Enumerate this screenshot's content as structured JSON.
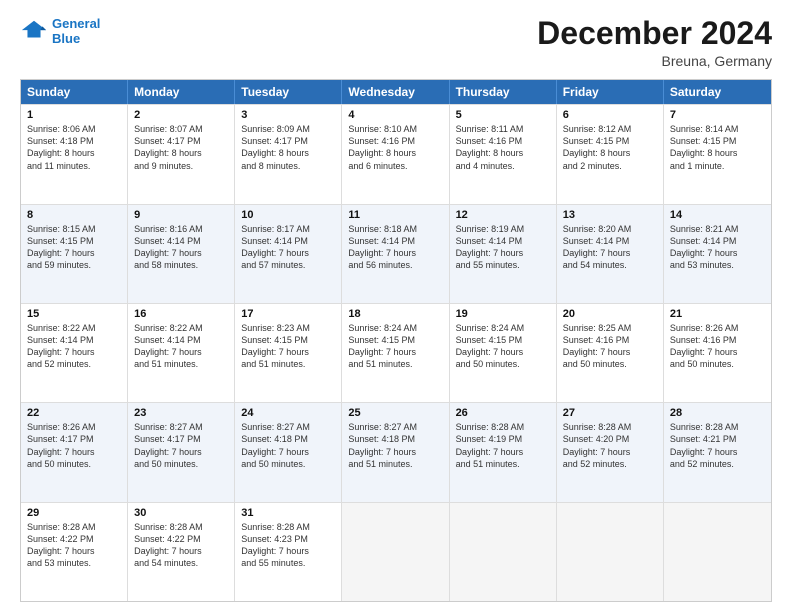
{
  "header": {
    "logo_line1": "General",
    "logo_line2": "Blue",
    "month": "December 2024",
    "location": "Breuna, Germany"
  },
  "weekdays": [
    "Sunday",
    "Monday",
    "Tuesday",
    "Wednesday",
    "Thursday",
    "Friday",
    "Saturday"
  ],
  "rows": [
    [
      {
        "day": "1",
        "lines": [
          "Sunrise: 8:06 AM",
          "Sunset: 4:18 PM",
          "Daylight: 8 hours",
          "and 11 minutes."
        ]
      },
      {
        "day": "2",
        "lines": [
          "Sunrise: 8:07 AM",
          "Sunset: 4:17 PM",
          "Daylight: 8 hours",
          "and 9 minutes."
        ]
      },
      {
        "day": "3",
        "lines": [
          "Sunrise: 8:09 AM",
          "Sunset: 4:17 PM",
          "Daylight: 8 hours",
          "and 8 minutes."
        ]
      },
      {
        "day": "4",
        "lines": [
          "Sunrise: 8:10 AM",
          "Sunset: 4:16 PM",
          "Daylight: 8 hours",
          "and 6 minutes."
        ]
      },
      {
        "day": "5",
        "lines": [
          "Sunrise: 8:11 AM",
          "Sunset: 4:16 PM",
          "Daylight: 8 hours",
          "and 4 minutes."
        ]
      },
      {
        "day": "6",
        "lines": [
          "Sunrise: 8:12 AM",
          "Sunset: 4:15 PM",
          "Daylight: 8 hours",
          "and 2 minutes."
        ]
      },
      {
        "day": "7",
        "lines": [
          "Sunrise: 8:14 AM",
          "Sunset: 4:15 PM",
          "Daylight: 8 hours",
          "and 1 minute."
        ]
      }
    ],
    [
      {
        "day": "8",
        "lines": [
          "Sunrise: 8:15 AM",
          "Sunset: 4:15 PM",
          "Daylight: 7 hours",
          "and 59 minutes."
        ]
      },
      {
        "day": "9",
        "lines": [
          "Sunrise: 8:16 AM",
          "Sunset: 4:14 PM",
          "Daylight: 7 hours",
          "and 58 minutes."
        ]
      },
      {
        "day": "10",
        "lines": [
          "Sunrise: 8:17 AM",
          "Sunset: 4:14 PM",
          "Daylight: 7 hours",
          "and 57 minutes."
        ]
      },
      {
        "day": "11",
        "lines": [
          "Sunrise: 8:18 AM",
          "Sunset: 4:14 PM",
          "Daylight: 7 hours",
          "and 56 minutes."
        ]
      },
      {
        "day": "12",
        "lines": [
          "Sunrise: 8:19 AM",
          "Sunset: 4:14 PM",
          "Daylight: 7 hours",
          "and 55 minutes."
        ]
      },
      {
        "day": "13",
        "lines": [
          "Sunrise: 8:20 AM",
          "Sunset: 4:14 PM",
          "Daylight: 7 hours",
          "and 54 minutes."
        ]
      },
      {
        "day": "14",
        "lines": [
          "Sunrise: 8:21 AM",
          "Sunset: 4:14 PM",
          "Daylight: 7 hours",
          "and 53 minutes."
        ]
      }
    ],
    [
      {
        "day": "15",
        "lines": [
          "Sunrise: 8:22 AM",
          "Sunset: 4:14 PM",
          "Daylight: 7 hours",
          "and 52 minutes."
        ]
      },
      {
        "day": "16",
        "lines": [
          "Sunrise: 8:22 AM",
          "Sunset: 4:14 PM",
          "Daylight: 7 hours",
          "and 51 minutes."
        ]
      },
      {
        "day": "17",
        "lines": [
          "Sunrise: 8:23 AM",
          "Sunset: 4:15 PM",
          "Daylight: 7 hours",
          "and 51 minutes."
        ]
      },
      {
        "day": "18",
        "lines": [
          "Sunrise: 8:24 AM",
          "Sunset: 4:15 PM",
          "Daylight: 7 hours",
          "and 51 minutes."
        ]
      },
      {
        "day": "19",
        "lines": [
          "Sunrise: 8:24 AM",
          "Sunset: 4:15 PM",
          "Daylight: 7 hours",
          "and 50 minutes."
        ]
      },
      {
        "day": "20",
        "lines": [
          "Sunrise: 8:25 AM",
          "Sunset: 4:16 PM",
          "Daylight: 7 hours",
          "and 50 minutes."
        ]
      },
      {
        "day": "21",
        "lines": [
          "Sunrise: 8:26 AM",
          "Sunset: 4:16 PM",
          "Daylight: 7 hours",
          "and 50 minutes."
        ]
      }
    ],
    [
      {
        "day": "22",
        "lines": [
          "Sunrise: 8:26 AM",
          "Sunset: 4:17 PM",
          "Daylight: 7 hours",
          "and 50 minutes."
        ]
      },
      {
        "day": "23",
        "lines": [
          "Sunrise: 8:27 AM",
          "Sunset: 4:17 PM",
          "Daylight: 7 hours",
          "and 50 minutes."
        ]
      },
      {
        "day": "24",
        "lines": [
          "Sunrise: 8:27 AM",
          "Sunset: 4:18 PM",
          "Daylight: 7 hours",
          "and 50 minutes."
        ]
      },
      {
        "day": "25",
        "lines": [
          "Sunrise: 8:27 AM",
          "Sunset: 4:18 PM",
          "Daylight: 7 hours",
          "and 51 minutes."
        ]
      },
      {
        "day": "26",
        "lines": [
          "Sunrise: 8:28 AM",
          "Sunset: 4:19 PM",
          "Daylight: 7 hours",
          "and 51 minutes."
        ]
      },
      {
        "day": "27",
        "lines": [
          "Sunrise: 8:28 AM",
          "Sunset: 4:20 PM",
          "Daylight: 7 hours",
          "and 52 minutes."
        ]
      },
      {
        "day": "28",
        "lines": [
          "Sunrise: 8:28 AM",
          "Sunset: 4:21 PM",
          "Daylight: 7 hours",
          "and 52 minutes."
        ]
      }
    ],
    [
      {
        "day": "29",
        "lines": [
          "Sunrise: 8:28 AM",
          "Sunset: 4:22 PM",
          "Daylight: 7 hours",
          "and 53 minutes."
        ]
      },
      {
        "day": "30",
        "lines": [
          "Sunrise: 8:28 AM",
          "Sunset: 4:22 PM",
          "Daylight: 7 hours",
          "and 54 minutes."
        ]
      },
      {
        "day": "31",
        "lines": [
          "Sunrise: 8:28 AM",
          "Sunset: 4:23 PM",
          "Daylight: 7 hours",
          "and 55 minutes."
        ]
      },
      null,
      null,
      null,
      null
    ]
  ]
}
